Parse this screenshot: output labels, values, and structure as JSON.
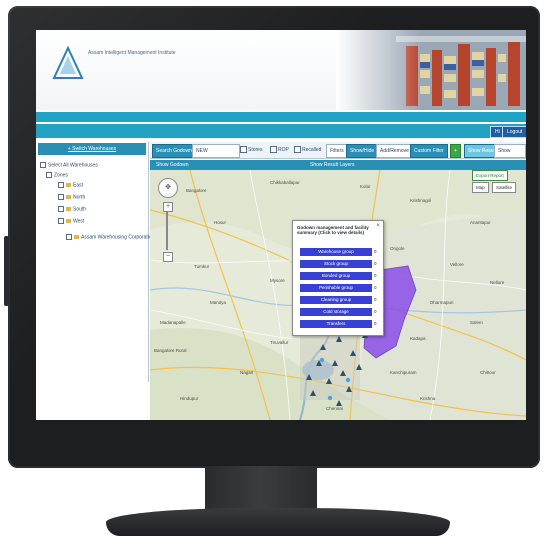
{
  "app": {
    "org_name": "Assam Intelligent Management Institute"
  },
  "header": {
    "user_buttons": [
      "Hi",
      "Logout"
    ]
  },
  "left_panel": {
    "head_label": "+ Switch Warehouses",
    "tree": [
      "Select All Warehouses",
      "Zones",
      "East",
      "North",
      "South",
      "West",
      "Assam Warehousing Corporation Godowns"
    ]
  },
  "toolbar": {
    "search_button": "Search Godown",
    "select_value": "NEW",
    "checkbox_labels": [
      "Stores",
      "ROP",
      "Recalled"
    ],
    "buttons": [
      "Filters",
      "Show/Hide",
      "Add/Remove",
      "Custom Filter"
    ],
    "right_buttons": [
      "Show Results",
      "Show Selected Data"
    ]
  },
  "subbar": {
    "left_label": "Show Godown",
    "center_label": "Show Result Layers",
    "report_label": "Export Report"
  },
  "map": {
    "type_buttons": [
      "Map",
      "Satellite"
    ],
    "labels": [
      "Bangalore",
      "Chikkaballapur",
      "Kolar",
      "Hosur",
      "Krishnagiri",
      "Tumkur",
      "Mandya",
      "Mysore",
      "Chennai",
      "Vellore",
      "Dharmapuri",
      "Salem",
      "Kanchipuram",
      "Tiruvallur",
      "Nagari",
      "Bangalore Rural",
      "Anantapur",
      "Chittoor",
      "Krishna",
      "Hindupur",
      "Madanapalle",
      "Kadapa",
      "Nellore",
      "Ongole"
    ],
    "colors": {
      "accent": "#22a3c4",
      "popup_rows": "#3840d6",
      "polygon": "#8a4ee8"
    }
  },
  "popup": {
    "title": "Godown management and facility summary (Click to view details)",
    "close": "×",
    "rows": [
      {
        "label": "Warehouse group",
        "count": "0"
      },
      {
        "label": "Stock group",
        "count": "0"
      },
      {
        "label": "Bonded group",
        "count": "0"
      },
      {
        "label": "Perishable group",
        "count": "0"
      },
      {
        "label": "Cleaning group",
        "count": "0"
      },
      {
        "label": "Cold storage",
        "count": "0"
      },
      {
        "label": "Transfers",
        "count": "0"
      }
    ]
  }
}
